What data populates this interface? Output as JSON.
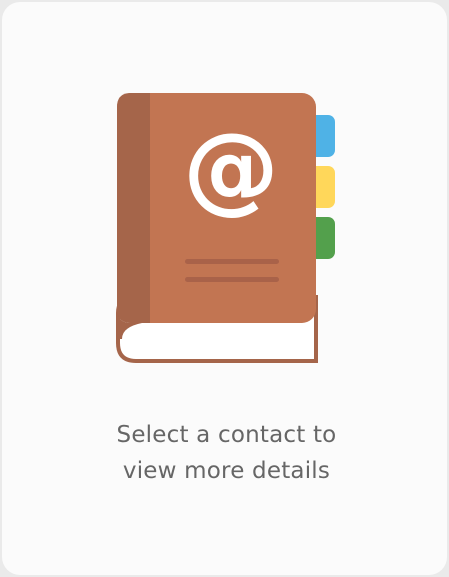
{
  "empty_state": {
    "icon": "address-book-icon",
    "icon_glyph": "@",
    "message_line1": "Select a contact to",
    "message_line2": "view more details"
  },
  "colors": {
    "book_cover": "#c27552",
    "book_spine": "#a5654a",
    "book_lines": "#a96249",
    "tab_blue": "#4fb2e6",
    "tab_yellow": "#ffd75a",
    "tab_green": "#53a04c",
    "text": "#666666"
  }
}
